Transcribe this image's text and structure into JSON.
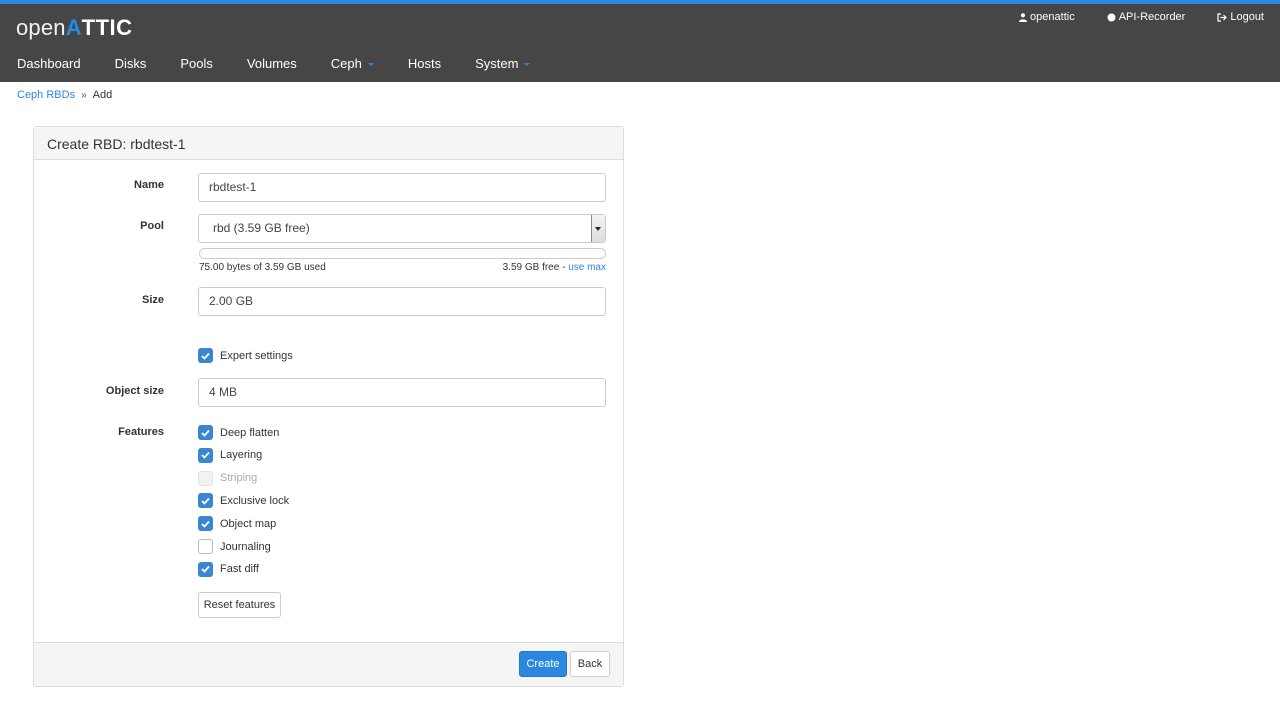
{
  "header": {
    "logo_open": "open",
    "logo_attic": "TTIC",
    "logo_a": "A",
    "user_label": "openattic",
    "recorder_label": "API-Recorder",
    "logout_label": "Logout"
  },
  "nav": {
    "items": [
      {
        "label": "Dashboard"
      },
      {
        "label": "Disks"
      },
      {
        "label": "Pools"
      },
      {
        "label": "Volumes"
      },
      {
        "label": "Ceph",
        "dropdown": true
      },
      {
        "label": "Hosts"
      },
      {
        "label": "System",
        "dropdown": true
      }
    ]
  },
  "breadcrumb": {
    "parent": "Ceph RBDs",
    "current": "Add"
  },
  "form": {
    "title": "Create RBD: rbdtest-1",
    "name_label": "Name",
    "name_value": "rbdtest-1",
    "pool_label": "Pool",
    "pool_value": "rbd (3.59 GB free)",
    "pool_usage_fraction": 0.0,
    "pool_used_text": "75.00 bytes of 3.59 GB used",
    "pool_free_text": "3.59 GB free - ",
    "use_max_label": "use max",
    "size_label": "Size",
    "size_value": "2.00 GB",
    "expert_label": "Expert settings",
    "expert_checked": true,
    "object_size_label": "Object size",
    "object_size_value": "4 MB",
    "features_label": "Features",
    "features": [
      {
        "label": "Deep flatten",
        "checked": true,
        "disabled": false
      },
      {
        "label": "Layering",
        "checked": true,
        "disabled": false
      },
      {
        "label": "Striping",
        "checked": false,
        "disabled": true
      },
      {
        "label": "Exclusive lock",
        "checked": true,
        "disabled": false
      },
      {
        "label": "Object map",
        "checked": true,
        "disabled": false
      },
      {
        "label": "Journaling",
        "checked": false,
        "disabled": false
      },
      {
        "label": "Fast diff",
        "checked": true,
        "disabled": false
      }
    ],
    "reset_label": "Reset features",
    "create_label": "Create",
    "back_label": "Back"
  },
  "colors": {
    "accent": "#2b88e0",
    "navbar": "#464646",
    "checkbox": "#3a86d1"
  }
}
